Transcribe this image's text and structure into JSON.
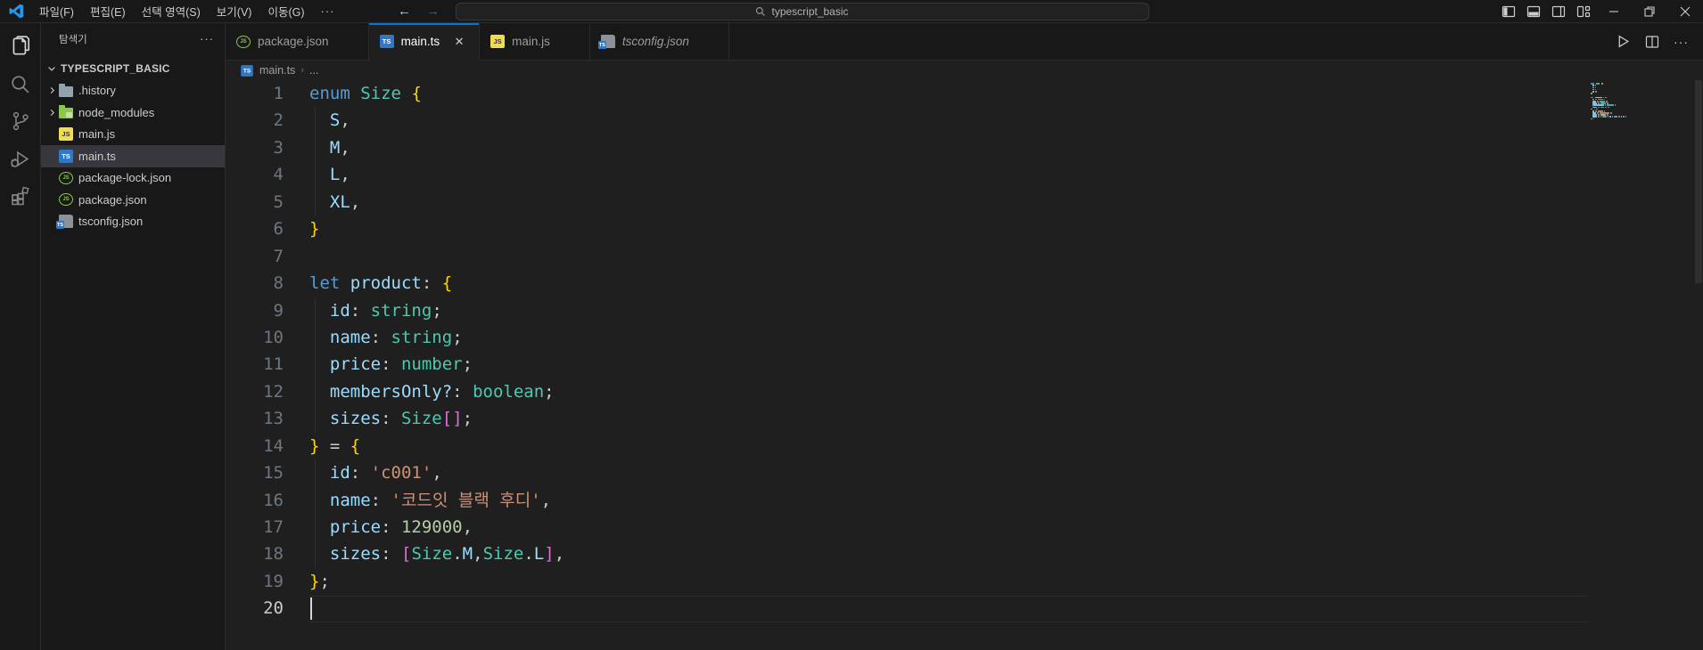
{
  "titlebar": {
    "menus": [
      "파일(F)",
      "편집(E)",
      "선택 영역(S)",
      "보기(V)",
      "이동(G)"
    ],
    "menu_overflow": "···",
    "search": {
      "value": "typescript_basic",
      "icon": "search-icon"
    },
    "window_controls": [
      "toggle-primary-sidebar",
      "toggle-panel",
      "toggle-secondary-sidebar",
      "customize-layout",
      "minimize",
      "restore",
      "close"
    ]
  },
  "activitybar": {
    "items": [
      {
        "name": "explorer",
        "icon": "files-icon",
        "active": true
      },
      {
        "name": "search",
        "icon": "search-icon",
        "active": false
      },
      {
        "name": "source-control",
        "icon": "git-branch-icon",
        "active": false
      },
      {
        "name": "run-debug",
        "icon": "debug-icon",
        "active": false
      },
      {
        "name": "extensions",
        "icon": "extensions-icon",
        "active": false
      }
    ]
  },
  "sidebar": {
    "title": "탐색기",
    "more": "···",
    "root": "TYPESCRIPT_BASIC",
    "files": [
      {
        "label": ".history",
        "icon": "folder-gray",
        "chevron": true
      },
      {
        "label": "node_modules",
        "icon": "folder-green",
        "chevron": true
      },
      {
        "label": "main.js",
        "icon": "js"
      },
      {
        "label": "main.ts",
        "icon": "ts",
        "selected": true
      },
      {
        "label": "package-lock.json",
        "icon": "node"
      },
      {
        "label": "package.json",
        "icon": "node"
      },
      {
        "label": "tsconfig.json",
        "icon": "ts-config"
      }
    ]
  },
  "tabs": [
    {
      "label": "package.json",
      "icon": "node",
      "active": false,
      "italic": false,
      "close": false
    },
    {
      "label": "main.ts",
      "icon": "ts",
      "active": true,
      "italic": false,
      "close": true
    },
    {
      "label": "main.js",
      "icon": "js",
      "active": false,
      "italic": false,
      "close": false
    },
    {
      "label": "tsconfig.json",
      "icon": "ts-config",
      "active": false,
      "italic": true,
      "close": false
    }
  ],
  "tab_close_glyph": "✕",
  "editor_actions": {
    "run": "run-button-icon",
    "split": "split-editor-icon",
    "more": "···"
  },
  "breadcrumb": {
    "file_icon": "ts",
    "file": "main.ts",
    "separator": "›",
    "more": "..."
  },
  "editor": {
    "cursor_line": 20,
    "lines": [
      {
        "n": 1,
        "guide": false,
        "tokens": [
          [
            "kw",
            "enum"
          ],
          [
            "pl",
            " "
          ],
          [
            "ty",
            "Size"
          ],
          [
            "pl",
            " "
          ],
          [
            "b1",
            "{"
          ]
        ]
      },
      {
        "n": 2,
        "guide": true,
        "tokens": [
          [
            "pl",
            "  "
          ],
          [
            "va",
            "S"
          ],
          [
            "pl",
            ","
          ]
        ]
      },
      {
        "n": 3,
        "guide": true,
        "tokens": [
          [
            "pl",
            "  "
          ],
          [
            "va",
            "M"
          ],
          [
            "pl",
            ","
          ]
        ]
      },
      {
        "n": 4,
        "guide": true,
        "tokens": [
          [
            "pl",
            "  "
          ],
          [
            "va",
            "L"
          ],
          [
            "pl",
            ","
          ]
        ]
      },
      {
        "n": 5,
        "guide": true,
        "tokens": [
          [
            "pl",
            "  "
          ],
          [
            "va",
            "XL"
          ],
          [
            "pl",
            ","
          ]
        ]
      },
      {
        "n": 6,
        "guide": false,
        "tokens": [
          [
            "b1",
            "}"
          ]
        ]
      },
      {
        "n": 7,
        "guide": false,
        "tokens": []
      },
      {
        "n": 8,
        "guide": false,
        "tokens": [
          [
            "kw",
            "let"
          ],
          [
            "pl",
            " "
          ],
          [
            "va",
            "product"
          ],
          [
            "pl",
            ": "
          ],
          [
            "b1",
            "{"
          ]
        ]
      },
      {
        "n": 9,
        "guide": true,
        "tokens": [
          [
            "pl",
            "  "
          ],
          [
            "va",
            "id"
          ],
          [
            "pl",
            ": "
          ],
          [
            "ty",
            "string"
          ],
          [
            "pl",
            ";"
          ]
        ]
      },
      {
        "n": 10,
        "guide": true,
        "tokens": [
          [
            "pl",
            "  "
          ],
          [
            "va",
            "name"
          ],
          [
            "pl",
            ": "
          ],
          [
            "ty",
            "string"
          ],
          [
            "pl",
            ";"
          ]
        ]
      },
      {
        "n": 11,
        "guide": true,
        "tokens": [
          [
            "pl",
            "  "
          ],
          [
            "va",
            "price"
          ],
          [
            "pl",
            ": "
          ],
          [
            "ty",
            "number"
          ],
          [
            "pl",
            ";"
          ]
        ]
      },
      {
        "n": 12,
        "guide": true,
        "tokens": [
          [
            "pl",
            "  "
          ],
          [
            "va",
            "membersOnly?"
          ],
          [
            "pl",
            ": "
          ],
          [
            "ty",
            "boolean"
          ],
          [
            "pl",
            ";"
          ]
        ]
      },
      {
        "n": 13,
        "guide": true,
        "tokens": [
          [
            "pl",
            "  "
          ],
          [
            "va",
            "sizes"
          ],
          [
            "pl",
            ": "
          ],
          [
            "ty",
            "Size"
          ],
          [
            "b2",
            "[]"
          ],
          [
            "pl",
            ";"
          ]
        ]
      },
      {
        "n": 14,
        "guide": false,
        "tokens": [
          [
            "b1",
            "}"
          ],
          [
            "pl",
            " = "
          ],
          [
            "b1",
            "{"
          ]
        ]
      },
      {
        "n": 15,
        "guide": true,
        "tokens": [
          [
            "pl",
            "  "
          ],
          [
            "va",
            "id"
          ],
          [
            "pl",
            ": "
          ],
          [
            "st",
            "'c001'"
          ],
          [
            "pl",
            ","
          ]
        ]
      },
      {
        "n": 16,
        "guide": true,
        "tokens": [
          [
            "pl",
            "  "
          ],
          [
            "va",
            "name"
          ],
          [
            "pl",
            ": "
          ],
          [
            "st",
            "'코드잇 블랙 후디'"
          ],
          [
            "pl",
            ","
          ]
        ]
      },
      {
        "n": 17,
        "guide": true,
        "tokens": [
          [
            "pl",
            "  "
          ],
          [
            "va",
            "price"
          ],
          [
            "pl",
            ": "
          ],
          [
            "nu",
            "129000"
          ],
          [
            "pl",
            ","
          ]
        ]
      },
      {
        "n": 18,
        "guide": true,
        "tokens": [
          [
            "pl",
            "  "
          ],
          [
            "va",
            "sizes"
          ],
          [
            "pl",
            ": "
          ],
          [
            "b2",
            "["
          ],
          [
            "ty",
            "Size"
          ],
          [
            "pl",
            "."
          ],
          [
            "va",
            "M"
          ],
          [
            "pl",
            ","
          ],
          [
            "ty",
            "Size"
          ],
          [
            "pl",
            "."
          ],
          [
            "va",
            "L"
          ],
          [
            "b2",
            "]"
          ],
          [
            "pl",
            ","
          ]
        ]
      },
      {
        "n": 19,
        "guide": false,
        "tokens": [
          [
            "b1",
            "}"
          ],
          [
            "pl",
            ";"
          ]
        ]
      },
      {
        "n": 20,
        "guide": false,
        "tokens": []
      }
    ]
  },
  "colors": {
    "accent_blue": "#0078d4",
    "keyword": "#569cd6",
    "type": "#4ec9b0",
    "variable": "#9cdcfe",
    "string": "#ce9178",
    "number": "#b5cea8",
    "brace_gold": "#ffd700",
    "bracket_pink": "#da70d6",
    "editor_bg": "#1f1f1f",
    "panel_bg": "#181818",
    "selected_row": "#37373d"
  }
}
